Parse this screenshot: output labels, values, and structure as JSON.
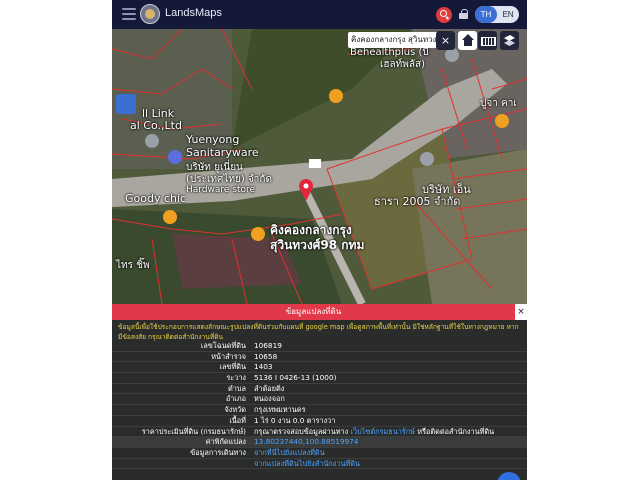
{
  "header": {
    "app_title": "LandsMaps",
    "lang_th": "TH",
    "lang_en": "EN",
    "menu_icon": "menu-icon",
    "search_icon": "search-icon",
    "lock_icon": "lock-icon",
    "accent": "#3b6fd4",
    "bar_color": "#14193a"
  },
  "map": {
    "search_text": "คิงคองกลางกรุง สุวินทวง",
    "close_label": "×",
    "labels": [
      "Behealthplus (บี",
      "เฮลท์พลัส)",
      "ll Link",
      "al Co.,Ltd",
      "Yuenyong",
      "Sanitaryware",
      "บริษัท ยูเนี่ยน",
      "(ประเทศไทย) จำกัด",
      "Hardware store",
      "Goody chic",
      "คิงคองกลางกรุง",
      "สุวินทวงศ์98 กทม",
      "บริษัท เอ็น",
      "ธารา 2005 จำกัด",
      "ปูจา คาเ",
      "ไทร ชิ๊พ"
    ],
    "parcel_color": "#e03030"
  },
  "panel": {
    "title": "ข้อมูลแปลงที่ดิน",
    "close_label": "×",
    "notice": "ข้อมูลนี้เพื่อใช้ประกอบการแสดงลักษณะรูปแปลงที่ดินร่วมกับแผนที่ google map เพื่อดูสภาพพื้นที่เท่านั้น มิใช่หลักฐานที่ใช้ในทางกฎหมาย หากมีข้อสงสัย กรุณาติดต่อสำนักงานที่ดิน",
    "rows": [
      {
        "label": "เลขโฉนดที่ดิน",
        "value": "106819"
      },
      {
        "label": "หน้าสำรวจ",
        "value": "10658"
      },
      {
        "label": "เลขที่ดิน",
        "value": "1403"
      },
      {
        "label": "ระวาง",
        "value": "5136 I 0426-13 (1000)"
      },
      {
        "label": "ตำบล",
        "value": "ลำต้อยติ่ง"
      },
      {
        "label": "อำเภอ",
        "value": "หนองจอก"
      },
      {
        "label": "จังหวัด",
        "value": "กรุงเทพมหานคร"
      },
      {
        "label": "เนื้อที่",
        "value": "1 ไร่ 0 งาน 0.0 ตารางวา"
      },
      {
        "label": "ราคาประเมินที่ดิน (กรมธนารักษ์)",
        "value_prefix": "กรุณาตรวจสอบข้อมูลผ่านทาง ",
        "value_link": "เว็บไซต์กรมธนารักษ์",
        "value_suffix": " หรือติดต่อสำนักงานที่ดิน"
      },
      {
        "label": "ค่าพิกัดแปลง",
        "value_link": "13.80237440,100.88519974"
      },
      {
        "label": "ข้อมูลการเดินทาง",
        "value_link": "จากที่นี่ไปยังแปลงที่ดิน"
      },
      {
        "label": "",
        "value_link": "จากแปลงที่ดินไปยังสำนักงานที่ดิน"
      }
    ]
  }
}
